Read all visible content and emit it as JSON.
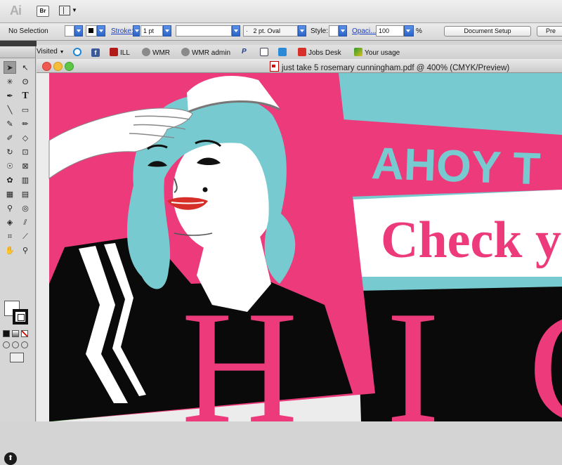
{
  "app": {
    "logo": "Ai",
    "bridge_label": "Br"
  },
  "control_bar": {
    "selection_label": "No Selection",
    "stroke_label": "Stroke:",
    "stroke_weight": "1 pt",
    "brush_value": "2 pt. Oval",
    "brush_bullet": "·",
    "style_label": "Style:",
    "opacity_label": "Opaci...",
    "opacity_value": "100",
    "opacity_unit": "%",
    "document_setup": "Document Setup",
    "preferences": "Pre"
  },
  "bookmarks": [
    {
      "label": "Visited",
      "icon": "menu-caret-icon"
    },
    {
      "label": "",
      "icon": "eye-icon"
    },
    {
      "label": "",
      "icon": "facebook-icon"
    },
    {
      "label": "ILL",
      "icon": "ill-icon"
    },
    {
      "label": "WMR",
      "icon": "globe-icon"
    },
    {
      "label": "WMR admin",
      "icon": "globe-icon"
    },
    {
      "label": "",
      "icon": "paypal-icon"
    },
    {
      "label": "",
      "icon": "bookmark-icon"
    },
    {
      "label": "",
      "icon": "calendar-icon"
    },
    {
      "label": "Jobs Desk",
      "icon": "jobs-icon"
    },
    {
      "label": "Your usage",
      "icon": "usage-icon"
    }
  ],
  "document": {
    "title": "just take 5 rosemary cunningham.pdf @ 400% (CMYK/Preview)"
  },
  "artwork": {
    "banner_text": "AHOY T",
    "subhead_text": "Check yo",
    "big_text": "H I C",
    "colors": {
      "pink": "#ec3a7b",
      "teal": "#77cbd0",
      "black": "#0a0a0a",
      "white": "#ffffff",
      "lips": "#d62f2a"
    }
  },
  "tools": [
    "selection",
    "direct-selection",
    "magic-wand",
    "lasso",
    "pen",
    "type",
    "line",
    "rectangle",
    "paintbrush",
    "pencil",
    "blob-brush",
    "eraser",
    "rotate",
    "scale",
    "warp",
    "free-transform",
    "symbol-sprayer",
    "column-graph",
    "mesh",
    "gradient",
    "eyedropper",
    "blend",
    "live-paint",
    "slice",
    "artboard",
    "slice-select",
    "hand",
    "zoom"
  ]
}
